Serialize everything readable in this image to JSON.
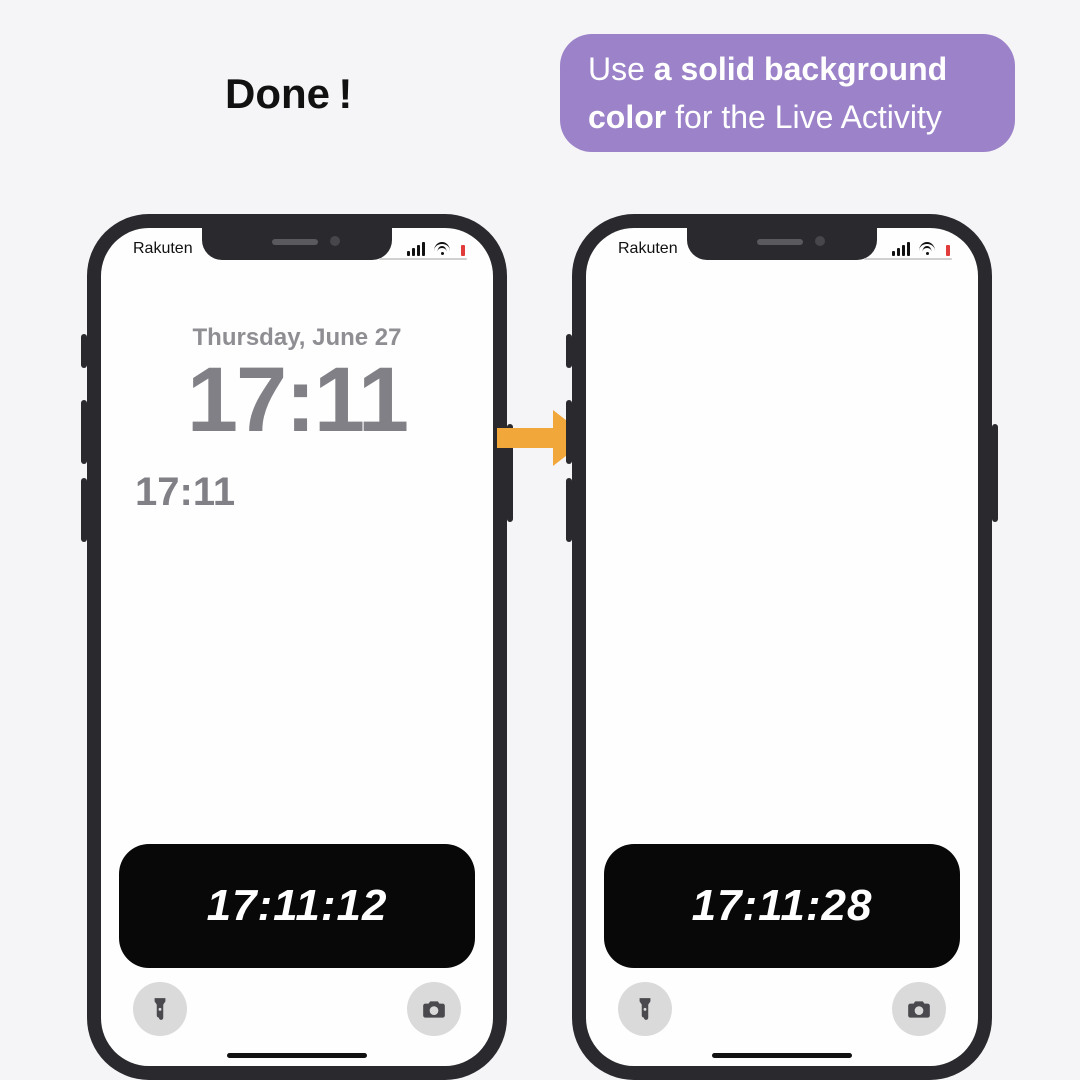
{
  "heading": "Done !",
  "tip": {
    "prefix": "Use ",
    "bold": "a solid background color",
    "suffix": " for the Live Activity"
  },
  "colors": {
    "bubble": "#9C83C9",
    "activity_bg": "#080808",
    "arrow": "#F2A73B"
  },
  "phones": {
    "left": {
      "carrier": "Rakuten",
      "lock_date": "Thursday, June 27",
      "lock_time": "17:11",
      "lock_time_sub": "17:11",
      "activity_time": "17:11:12"
    },
    "right": {
      "carrier": "Rakuten",
      "activity_time": "17:11:28"
    }
  },
  "icons": {
    "flashlight": "flashlight-icon",
    "camera": "camera-icon"
  }
}
